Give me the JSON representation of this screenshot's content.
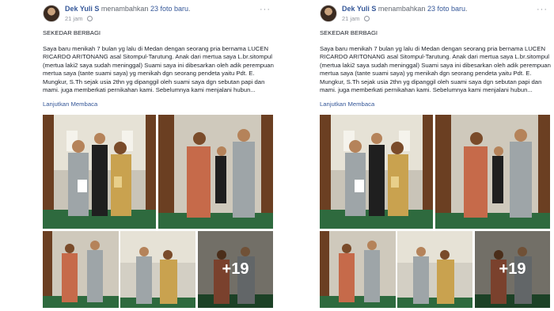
{
  "posts": [
    {
      "author": "Dek Yuli S",
      "verb_prefix": "menambahkan",
      "verb_link": "23 foto baru",
      "verb_suffix": ".",
      "time": "21 jam",
      "more_icon": "more-icon",
      "globe_icon": "globe-icon",
      "title": "SEKEDAR BERBAGI",
      "body": "Saya baru menikah 7 bulan yg lalu di Medan dengan seorang pria bernama LUCEN RICARDO ARITONANG asal Sitompul-Tarutung. Anak dari mertua saya L.br.sitompul (mertua laki2 saya sudah meninggal) Suami saya ini dibesarkan oleh adik perempuan mertua saya (tante suami saya) yg menikah dgn seorang pendeta yaitu Pdt. E. Mungkur, S.Th sejak usia 2thn yg dipanggil oleh suami saya dgn sebutan papi dan mami. juga memberkati pernikahan kami. Sebelumnya kami menjalani hubun...",
      "see_more": "Lanjutkan Membaca",
      "more_photos": "+19"
    },
    {
      "author": "Dek Yuli S",
      "verb_prefix": "menambahkan",
      "verb_link": "23 foto baru",
      "verb_suffix": ".",
      "time": "21 jam",
      "more_icon": "more-icon",
      "globe_icon": "globe-icon",
      "title": "SEKEDAR BERBAGI",
      "body": "Saya baru menikah 7 bulan yg lalu di Medan dengan seorang pria bernama LUCEN RICARDO ARITONANG asal Sitompul-Tarutung. Anak dari mertua saya L.br.sitompul (mertua laki2 saya sudah meninggal) Suami saya ini dibesarkan oleh adik perempuan mertua saya (tante suami saya) yg menikah dgn seorang pendeta yaitu Pdt. E. Mungkur, S.Th sejak usia 2thn yg dipanggil oleh suami saya dgn sebutan papi dan mami. juga memberkati pernikahan kami. Sebelumnya kami menjalani hubun...",
      "see_more": "Lanjutkan Membaca",
      "more_photos": "+19"
    }
  ],
  "colors": {
    "link": "#365899",
    "meta": "#90949c",
    "text": "#1d2129"
  }
}
